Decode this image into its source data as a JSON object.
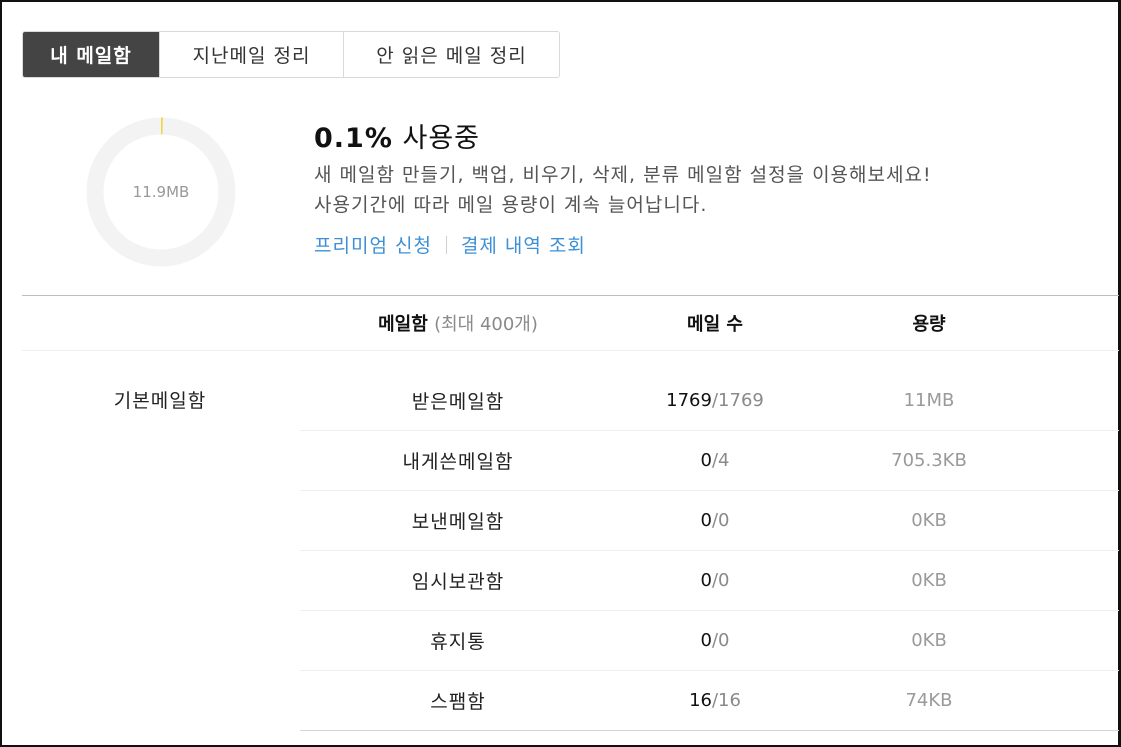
{
  "tabs": [
    {
      "label": "내 메일함",
      "active": true
    },
    {
      "label": "지난메일 정리",
      "active": false
    },
    {
      "label": "안 읽은 메일 정리",
      "active": false
    }
  ],
  "usage": {
    "total_size": "11.9MB",
    "percent_text": "0.1%",
    "status_text": "사용중",
    "used_fraction": 0.001,
    "ring_color": "#f3f3f3",
    "used_color": "#f0d44a",
    "description_line1": "새 메일함 만들기, 백업, 비우기, 삭제, 분류 메일함 설정을 이용해보세요!",
    "description_line2": "사용기간에 따라 메일 용량이 계속 늘어납니다."
  },
  "links": {
    "premium": "프리미엄 신청",
    "payment_history": "결제 내역 조회",
    "link_color": "#3d8fd6"
  },
  "table": {
    "header_mailbox": "메일함",
    "header_mailbox_note": "(최대 400개)",
    "header_count": "메일 수",
    "header_size": "용량",
    "group_label": "기본메일함",
    "rows": [
      {
        "name": "받은메일함",
        "unread": "1769",
        "total": "/1769",
        "size": "11MB"
      },
      {
        "name": "내게쓴메일함",
        "unread": "0",
        "total": "/4",
        "size": "705.3KB"
      },
      {
        "name": "보낸메일함",
        "unread": "0",
        "total": "/0",
        "size": "0KB"
      },
      {
        "name": "임시보관함",
        "unread": "0",
        "total": "/0",
        "size": "0KB"
      },
      {
        "name": "휴지통",
        "unread": "0",
        "total": "/0",
        "size": "0KB"
      },
      {
        "name": "스팸함",
        "unread": "16",
        "total": "/16",
        "size": "74KB"
      }
    ]
  }
}
